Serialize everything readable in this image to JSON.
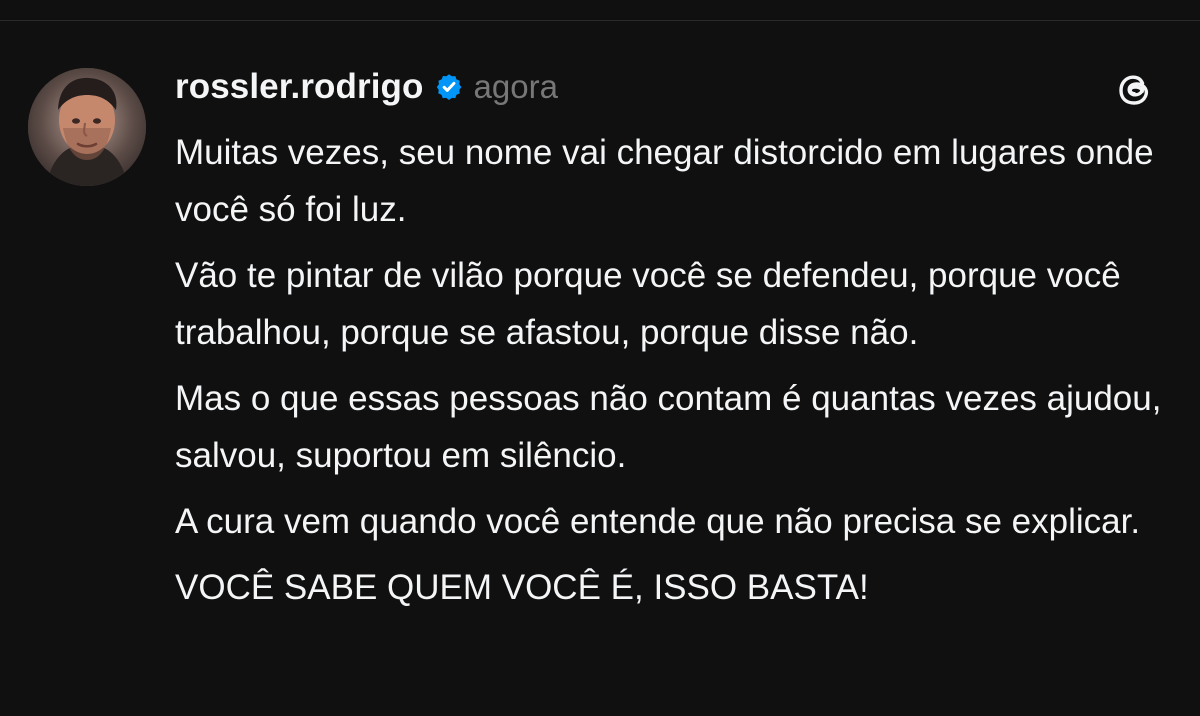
{
  "post": {
    "username": "rossler.rodrigo",
    "timestamp": "agora",
    "verified": true,
    "paragraphs": [
      "Muitas vezes, seu nome vai chegar distorcido em lugares onde você só foi luz.",
      "Vão te pintar de vilão porque você se defendeu, porque você trabalhou, porque se afastou, porque disse não.",
      "Mas o que essas pessoas não contam é quantas vezes ajudou, salvou, suportou em silêncio.",
      "A cura vem quando você entende que não precisa se explicar.",
      "VOCÊ SABE QUEM VOCÊ É, ISSO BASTA!"
    ]
  },
  "icons": {
    "avatar": "profile-photo",
    "verified": "verified-badge-icon",
    "app": "threads-logo-icon"
  },
  "colors": {
    "background": "#101010",
    "text_primary": "#f3f5f7",
    "text_secondary": "#777777",
    "verified_blue": "#0095f6"
  }
}
